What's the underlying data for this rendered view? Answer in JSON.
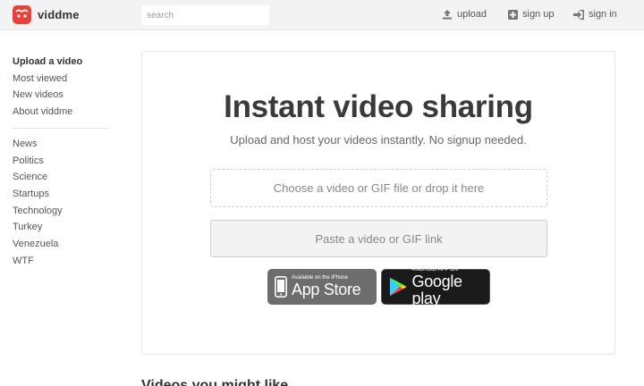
{
  "header": {
    "logo_text": "viddme",
    "search_placeholder": "search",
    "nav": {
      "upload": "upload",
      "signup": "sign up",
      "signin": "sign in"
    }
  },
  "sidebar": {
    "primary": [
      "Upload a video",
      "Most viewed",
      "New videos",
      "About viddme"
    ],
    "channels": [
      "News",
      "Politics",
      "Science",
      "Startups",
      "Technology",
      "Turkey",
      "Venezuela",
      "WTF"
    ]
  },
  "main": {
    "headline": "Instant video sharing",
    "subline": "Upload and host your videos instantly. No signup needed.",
    "dropzone_label": "Choose a video or GIF file or drop it here",
    "link_label": "Paste a video or GIF link",
    "app_store": {
      "small": "Available on the iPhone",
      "big": "App Store"
    },
    "google_play": {
      "small": "ANDROID APP ON",
      "big": "Google play"
    }
  },
  "bottom": {
    "heading": "Videos you might like"
  },
  "colors": {
    "brand": "#e8403b",
    "header_bg": "#f3f3f3"
  }
}
